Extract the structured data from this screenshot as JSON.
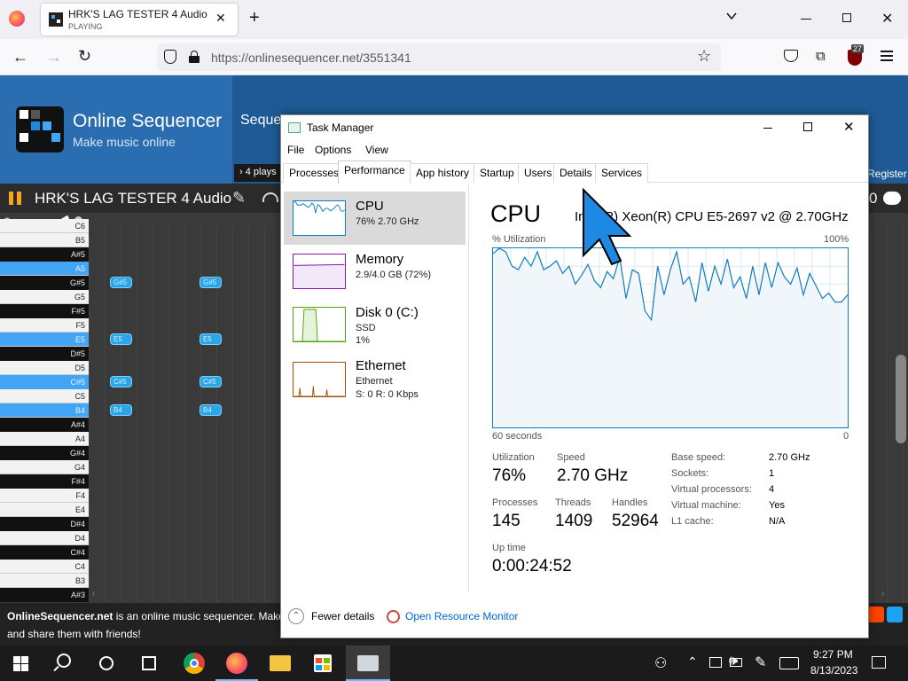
{
  "browser": {
    "tab_title": "HRK'S LAG TESTER 4 Audio - O",
    "tab_status": "PLAYING",
    "url_host": "https://onlinesequencer.net",
    "url_path": "/3551341",
    "extension_badge": "27"
  },
  "site": {
    "title": "Online Sequencer",
    "tagline": "Make music online",
    "nav_partial": "Seque",
    "plays": "4 plays",
    "register": "Register",
    "song_title": "HRK'S LAG TESTER 4 Audio",
    "right_count": "0",
    "footer_brand": "OnlineSequencer.net",
    "footer_text": " is an online music sequencer. Make tun",
    "footer_text2": "and share them with friends!",
    "keys": [
      {
        "label": "C6",
        "type": "white",
        "hl": false
      },
      {
        "label": "B5",
        "type": "white",
        "hl": false
      },
      {
        "label": "A#5",
        "type": "black",
        "hl": false
      },
      {
        "label": "A5",
        "type": "white",
        "hl": true
      },
      {
        "label": "G#5",
        "type": "black",
        "hl": false
      },
      {
        "label": "G5",
        "type": "white",
        "hl": false
      },
      {
        "label": "F#5",
        "type": "black",
        "hl": false
      },
      {
        "label": "F5",
        "type": "white",
        "hl": false
      },
      {
        "label": "E5",
        "type": "white",
        "hl": true
      },
      {
        "label": "D#5",
        "type": "black",
        "hl": false
      },
      {
        "label": "D5",
        "type": "white",
        "hl": false
      },
      {
        "label": "C#5",
        "type": "black",
        "hl": true
      },
      {
        "label": "C5",
        "type": "white",
        "hl": false
      },
      {
        "label": "B4",
        "type": "white",
        "hl": true
      },
      {
        "label": "A#4",
        "type": "black",
        "hl": false
      },
      {
        "label": "A4",
        "type": "white",
        "hl": false
      },
      {
        "label": "G#4",
        "type": "black",
        "hl": false
      },
      {
        "label": "G4",
        "type": "white",
        "hl": false
      },
      {
        "label": "F#4",
        "type": "black",
        "hl": false
      },
      {
        "label": "F4",
        "type": "white",
        "hl": false
      },
      {
        "label": "E4",
        "type": "white",
        "hl": false
      },
      {
        "label": "D#4",
        "type": "black",
        "hl": false
      },
      {
        "label": "D4",
        "type": "white",
        "hl": false
      },
      {
        "label": "C#4",
        "type": "black",
        "hl": false
      },
      {
        "label": "C4",
        "type": "white",
        "hl": false
      },
      {
        "label": "B3",
        "type": "white",
        "hl": false
      },
      {
        "label": "A#3",
        "type": "black",
        "hl": false
      }
    ],
    "notes": [
      "G#5",
      "G#5",
      "E5",
      "E5",
      "C#5",
      "C#5",
      "B4",
      "B4"
    ]
  },
  "taskmanager": {
    "title": "Task Manager",
    "menu": [
      "File",
      "Options",
      "View"
    ],
    "tabs": [
      "Processes",
      "Performance",
      "App history",
      "Startup",
      "Users",
      "Details",
      "Services"
    ],
    "active_tab": "Performance",
    "resources": [
      {
        "name": "CPU",
        "sub1": "76%  2.70 GHz",
        "sub2": "",
        "sub3": ""
      },
      {
        "name": "Memory",
        "sub1": "2.9/4.0 GB (72%)",
        "sub2": "",
        "sub3": ""
      },
      {
        "name": "Disk 0 (C:)",
        "sub1": "SSD",
        "sub2": "1%",
        "sub3": ""
      },
      {
        "name": "Ethernet",
        "sub1": "Ethernet",
        "sub2": "S: 0 R: 0 Kbps",
        "sub3": ""
      }
    ],
    "main": {
      "heading": "CPU",
      "cpu_model": "Intel(R) Xeon(R) CPU E5-2697 v2 @ 2.70GHz",
      "graph_label": "% Utilization",
      "graph_max": "100%",
      "graph_time": "60 seconds",
      "graph_min": "0",
      "utilization_graph": [
        97,
        100,
        98,
        90,
        88,
        95,
        90,
        98,
        88,
        90,
        93,
        86,
        90,
        80,
        85,
        91,
        82,
        78,
        87,
        83,
        95,
        72,
        88,
        86,
        65,
        60,
        90,
        74,
        88,
        98,
        80,
        84,
        70,
        92,
        76,
        90,
        80,
        94,
        78,
        84,
        72,
        90,
        74,
        92,
        78,
        92,
        84,
        80,
        89,
        74,
        86,
        79,
        72,
        75,
        70,
        70,
        74
      ],
      "utilization_label": "Utilization",
      "utilization_value": "76%",
      "speed_label": "Speed",
      "speed_value": "2.70 GHz",
      "processes_label": "Processes",
      "processes_value": "145",
      "threads_label": "Threads",
      "threads_value": "1409",
      "handles_label": "Handles",
      "handles_value": "52964",
      "uptime_label": "Up time",
      "uptime_value": "0:00:24:52",
      "specs": [
        {
          "k": "Base speed:",
          "v": "2.70 GHz"
        },
        {
          "k": "Sockets:",
          "v": "1"
        },
        {
          "k": "Virtual processors:",
          "v": "4"
        },
        {
          "k": "Virtual machine:",
          "v": "Yes"
        },
        {
          "k": "L1 cache:",
          "v": "N/A"
        }
      ]
    },
    "footer": {
      "fewer_details": "Fewer details",
      "open_resource_monitor": "Open Resource Monitor"
    }
  },
  "taskbar": {
    "time": "9:27 PM",
    "date": "8/13/2023"
  },
  "colors": {
    "cpu_graph_line": "#117dbb",
    "cpu_graph_fill": "#f1f6fa",
    "memory_graph": "#8b12ae",
    "disk_graph": "#4da60c",
    "ethernet_graph": "#a74f01",
    "site_blue": "#2a6db0"
  }
}
